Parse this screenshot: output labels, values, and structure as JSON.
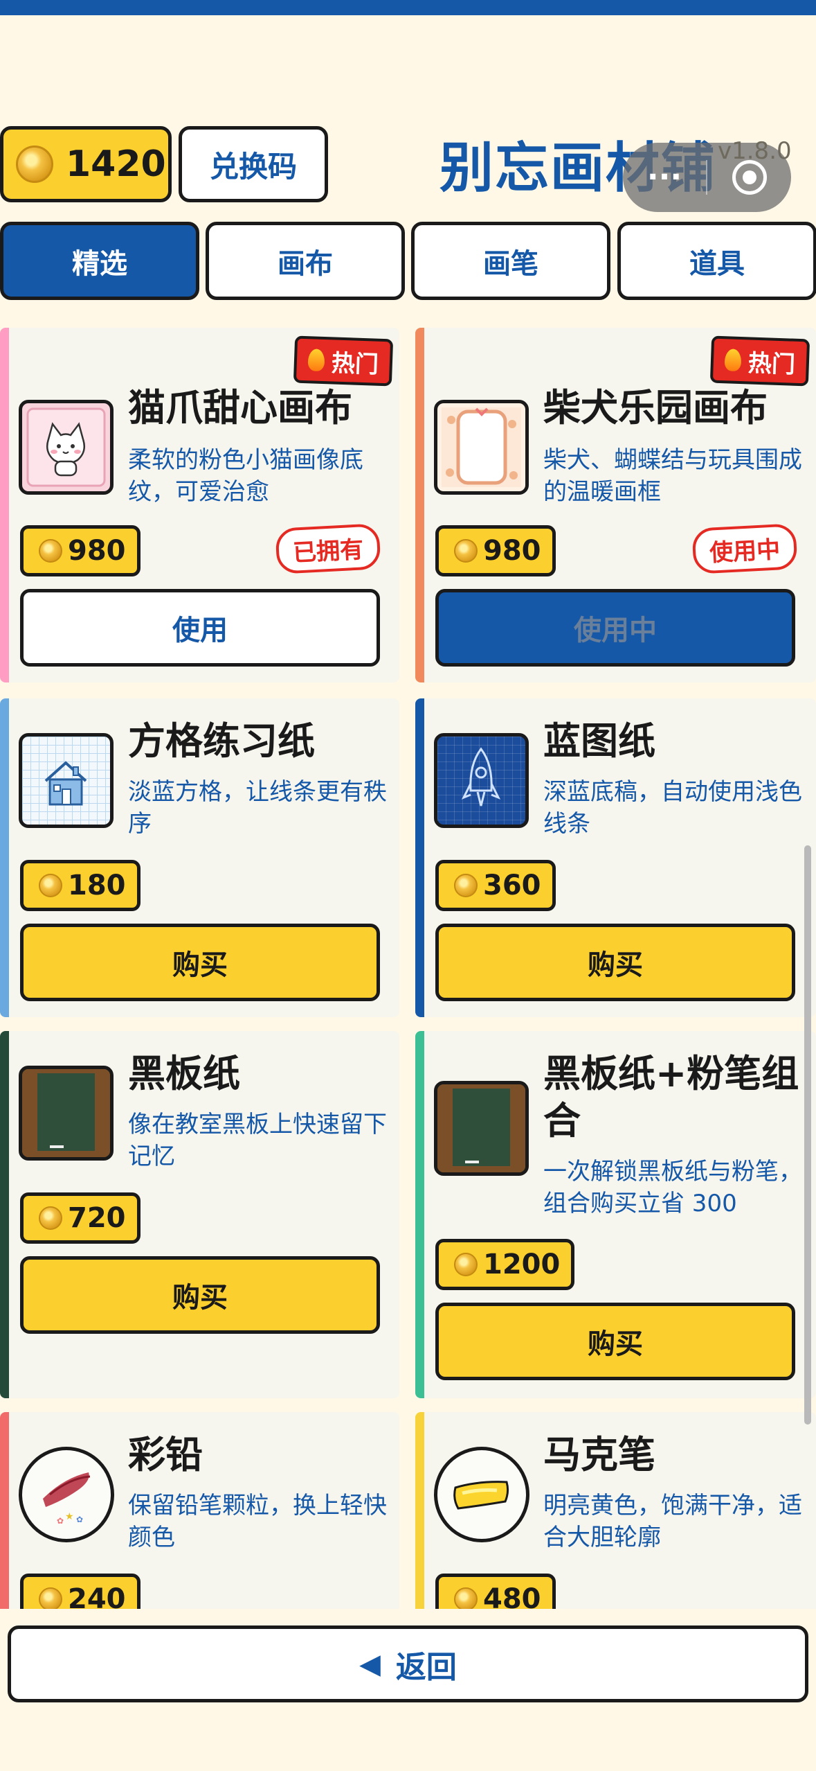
{
  "header": {
    "coins": "1420",
    "redeem_label": "兑换码",
    "title": "别忘画材铺",
    "version": "v1.8.0",
    "capsule_more": "···"
  },
  "tabs": [
    {
      "label": "精选",
      "active": true
    },
    {
      "label": "画布",
      "active": false
    },
    {
      "label": "画笔",
      "active": false
    },
    {
      "label": "道具",
      "active": false
    }
  ],
  "products": [
    {
      "name": "猫爪甜心画布",
      "desc": "柔软的粉色小猫画像底纹，可爱治愈",
      "price": "980",
      "hot": "热门",
      "status": "已拥有",
      "button": "使用",
      "stripe_color": "#ff9ec2"
    },
    {
      "name": "柴犬乐园画布",
      "desc": "柴犬、蝴蝶结与玩具围成的温暖画框",
      "price": "980",
      "hot": "热门",
      "status": "使用中",
      "button": "使用中",
      "stripe_color": "#f08a5d"
    },
    {
      "name": "方格练习纸",
      "desc": "淡蓝方格，让线条更有秩序",
      "price": "180",
      "button": "购买",
      "stripe_color": "#6aa8e0"
    },
    {
      "name": "蓝图纸",
      "desc": "深蓝底稿，自动使用浅色线条",
      "price": "360",
      "button": "购买",
      "stripe_color": "#1558a8"
    },
    {
      "name": "黑板纸",
      "desc": "像在教室黑板上快速留下记忆",
      "price": "720",
      "button": "购买",
      "stripe_color": "#244a3a"
    },
    {
      "name": "黑板纸+粉笔组合",
      "desc": "一次解锁黑板纸与粉笔，组合购买立省 300",
      "price": "1200",
      "button": "购买",
      "stripe_color": "#3cbf94"
    },
    {
      "name": "彩铅",
      "desc": "保留铅笔颗粒，换上轻快颜色",
      "price": "240",
      "stripe_color": "#f26b6b"
    },
    {
      "name": "马克笔",
      "desc": "明亮黄色，饱满干净，适合大胆轮廓",
      "price": "480",
      "stripe_color": "#f7d23a"
    }
  ],
  "back_label": "返回",
  "colors": {
    "brand_blue": "#1558a8",
    "coin_yellow": "#fbcf2d",
    "hot_red": "#e42a22",
    "background": "#fff8e6"
  }
}
